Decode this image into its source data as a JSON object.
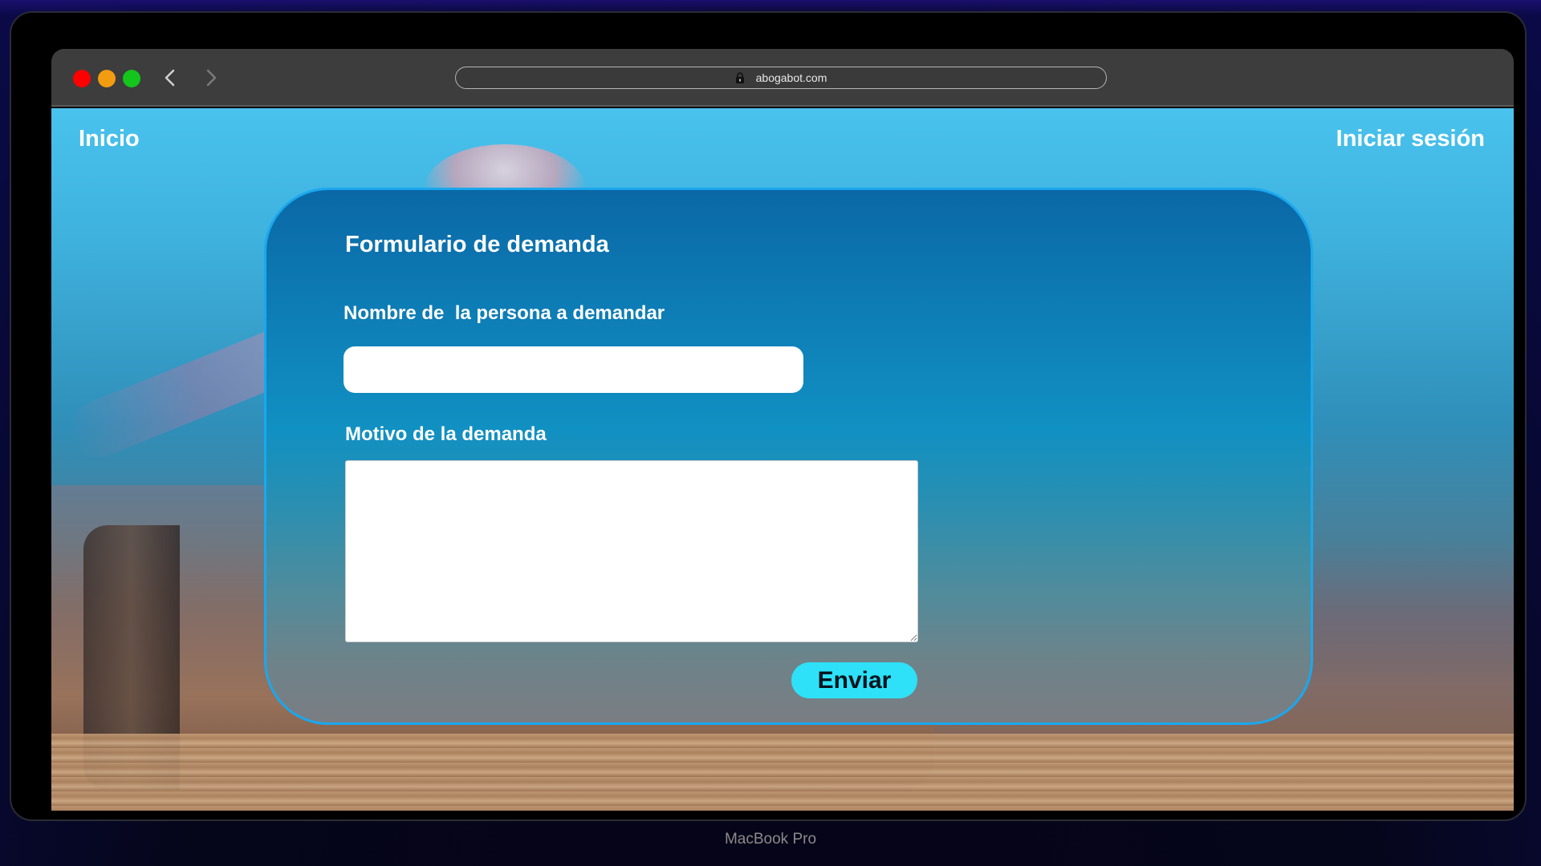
{
  "browser": {
    "url": "abogabot.com"
  },
  "nav": {
    "home_label": "Inicio",
    "login_label": "Iniciar sesión"
  },
  "form": {
    "title": "Formulario de demanda",
    "name_label": "Nombre de  la persona a demandar",
    "name_value": "",
    "reason_label": "Motivo de la demanda",
    "reason_value": "",
    "submit_label": "Enviar"
  },
  "device": {
    "label": "MacBook Pro"
  },
  "colors": {
    "accent_button": "#2ee0f8",
    "card_border": "#1aa8ee",
    "traffic_red": "#fe0000",
    "traffic_yellow": "#f29c11",
    "traffic_green": "#14c51b"
  },
  "icons": [
    "lock-icon",
    "chevron-left-icon",
    "chevron-right-icon"
  ]
}
